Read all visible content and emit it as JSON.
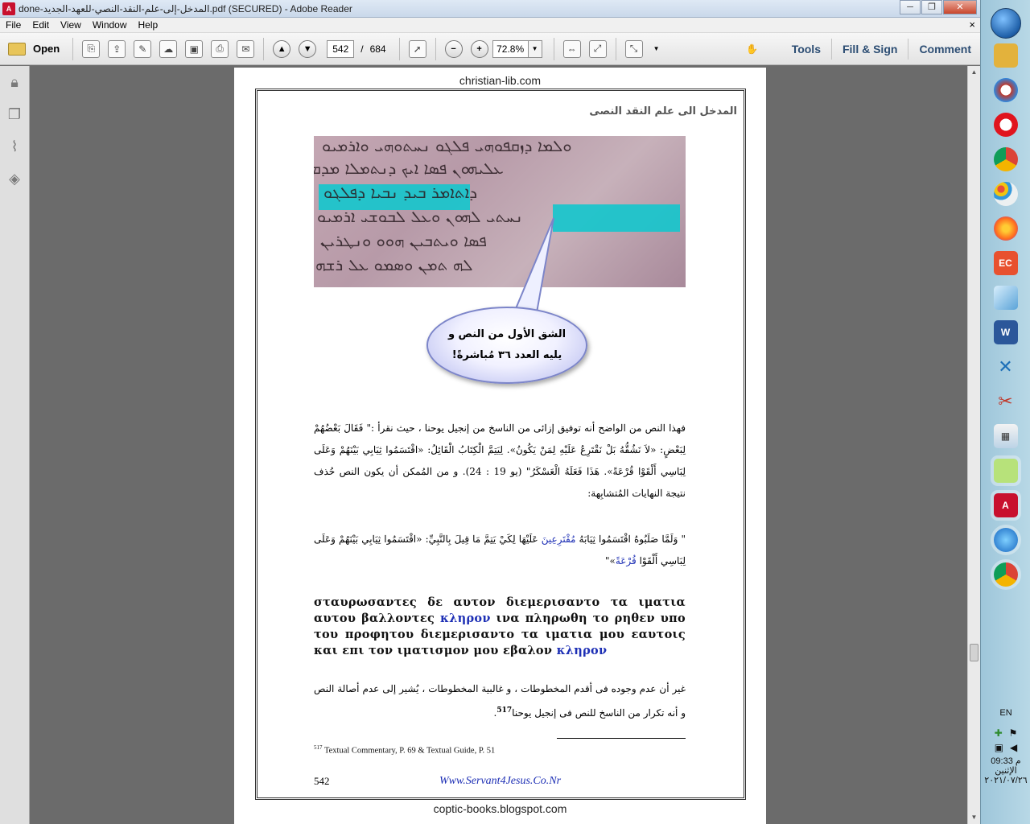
{
  "window": {
    "title": "done-المدخل-إلى-علم-النقد-النصي-للعهد-الجديد.pdf (SECURED) - Adobe Reader",
    "minimize": "─",
    "restore": "❐",
    "close": "✕"
  },
  "menu": {
    "items": [
      "File",
      "Edit",
      "View",
      "Window",
      "Help"
    ],
    "close_doc": "×"
  },
  "toolbar": {
    "open_label": "Open",
    "page_current": "542",
    "page_sep": "/",
    "page_total": "684",
    "zoom": "72.8%",
    "tools": "Tools",
    "fill_sign": "Fill & Sign",
    "comment": "Comment"
  },
  "page": {
    "header_url": "christian-lib.com",
    "footer_url": "coptic-books.blogspot.com",
    "running_head": "المدخل الى علم النقد النصى",
    "manuscript_lines": [
      "ܘܠܡܐ ܕܙܩܦܘܗܝ ܦܠܓܘ ܢܚܬܘܗܝ ܘܐܪܡܝܘ",
      "ܥܠܝܗܘܢ ܦܣܐ ܐܝܟ ܕܢܬܡܠܐ ܡܕܡ",
      "ܕܐܬܐܡܪ ܒܝܕ ܢܒܝܐ ܕܦܠܓܘ",
      "ܢܚܬܝ ܠܗܘܢ ܘܥܠ ܠܒܘܫܝ ܐܪܡܝܘ",
      "ܦܣܐ ܘܝܬܒܝܢ ܗܘܘ ܘܢܛܪܝܢ",
      "ܠܗ ܬܡܢ ܘܣܡܘ ܥܠ ܪܫܗ"
    ],
    "callout_line1": "الشق الأول من النص و",
    "callout_line2": "يليه العدد ٣٦ مُباشرةً!",
    "para1": "فهذا النص من الواضح أنه توفيق إزائى من الناسخ من إنجيل يوحنا ، حيث نقرأ :\" فَقَالَ بَعْضُهُمْ لِبَعْضٍ: «لاَ نَشُقُّهُ بَلْ نَقْتَرِعُ عَلَيْهِ لِمَنْ يَكُونُ». لِيَتِمَّ الْكِتَابُ الْقَائِلُ: «اقْتَسَمُوا ثِيَابِي بَيْنَهُمْ وَعَلَى لِبَاسِي أَلْقَوْا قُرْعَةً». هَذَا فَعَلَهُ الْعَسْكَرُ\" (يو 19 : 24). و من المُمكن أن يكون النص حُذف نتيجة النهايات المُتشابِهة:",
    "para2_a": "\" وَلَمَّا صَلَبُوهُ اقْتَسَمُوا ثِيَابَهُ ",
    "para2_b": "مُقْتَرِعِينَ",
    "para2_c": " عَلَيْهَا لِكَيْ يَتِمَّ مَا قِيلَ بِالنَّبِيِّ: «اقْتَسَمُوا ثِيَابِي بَيْنَهُمْ وَعَلَى لِبَاسِي أَلْقَوْا ",
    "para2_d": "قُرْعَةً",
    "para2_e": "»\"",
    "greek_a": "σταυρωσαντες δε αυτον διεμερισαντο τα ιματια αυτου βαλλοντες ",
    "greek_b": "κληρον",
    "greek_c": " ινα πληρωθη το ρηθεν υπο του προφητου διεμερισαντο τα ιματια μου εαυτοις και επι τον ιματισμον μου εβαλον ",
    "greek_d": "κληρον",
    "para3": "غير أن عدم وجوده فى أقدم المخطوطات ، و غالبية المخطوطات ، يُشير إلى عدم أصالة النص و أنه تكرار من الناسخ للنص فى إنجيل يوحنا",
    "para3_sup": "517",
    "para3_end": ".",
    "footnote_num": "517",
    "footnote_text": "Textual Commentary, P. 69 & Textual Guide, P. 51",
    "page_number": "542",
    "site": "Www.Servant4Jesus.Co.Nr"
  },
  "taskbar": {
    "lang": "EN",
    "time": "09:33 م",
    "day": "الإثنين",
    "date": "٢٠٢١/٠٧/٢٦"
  },
  "colors": {
    "highlight": "#17c6cc",
    "link_blue": "#1d2fb5",
    "toolbar_link": "#2c4d73"
  }
}
